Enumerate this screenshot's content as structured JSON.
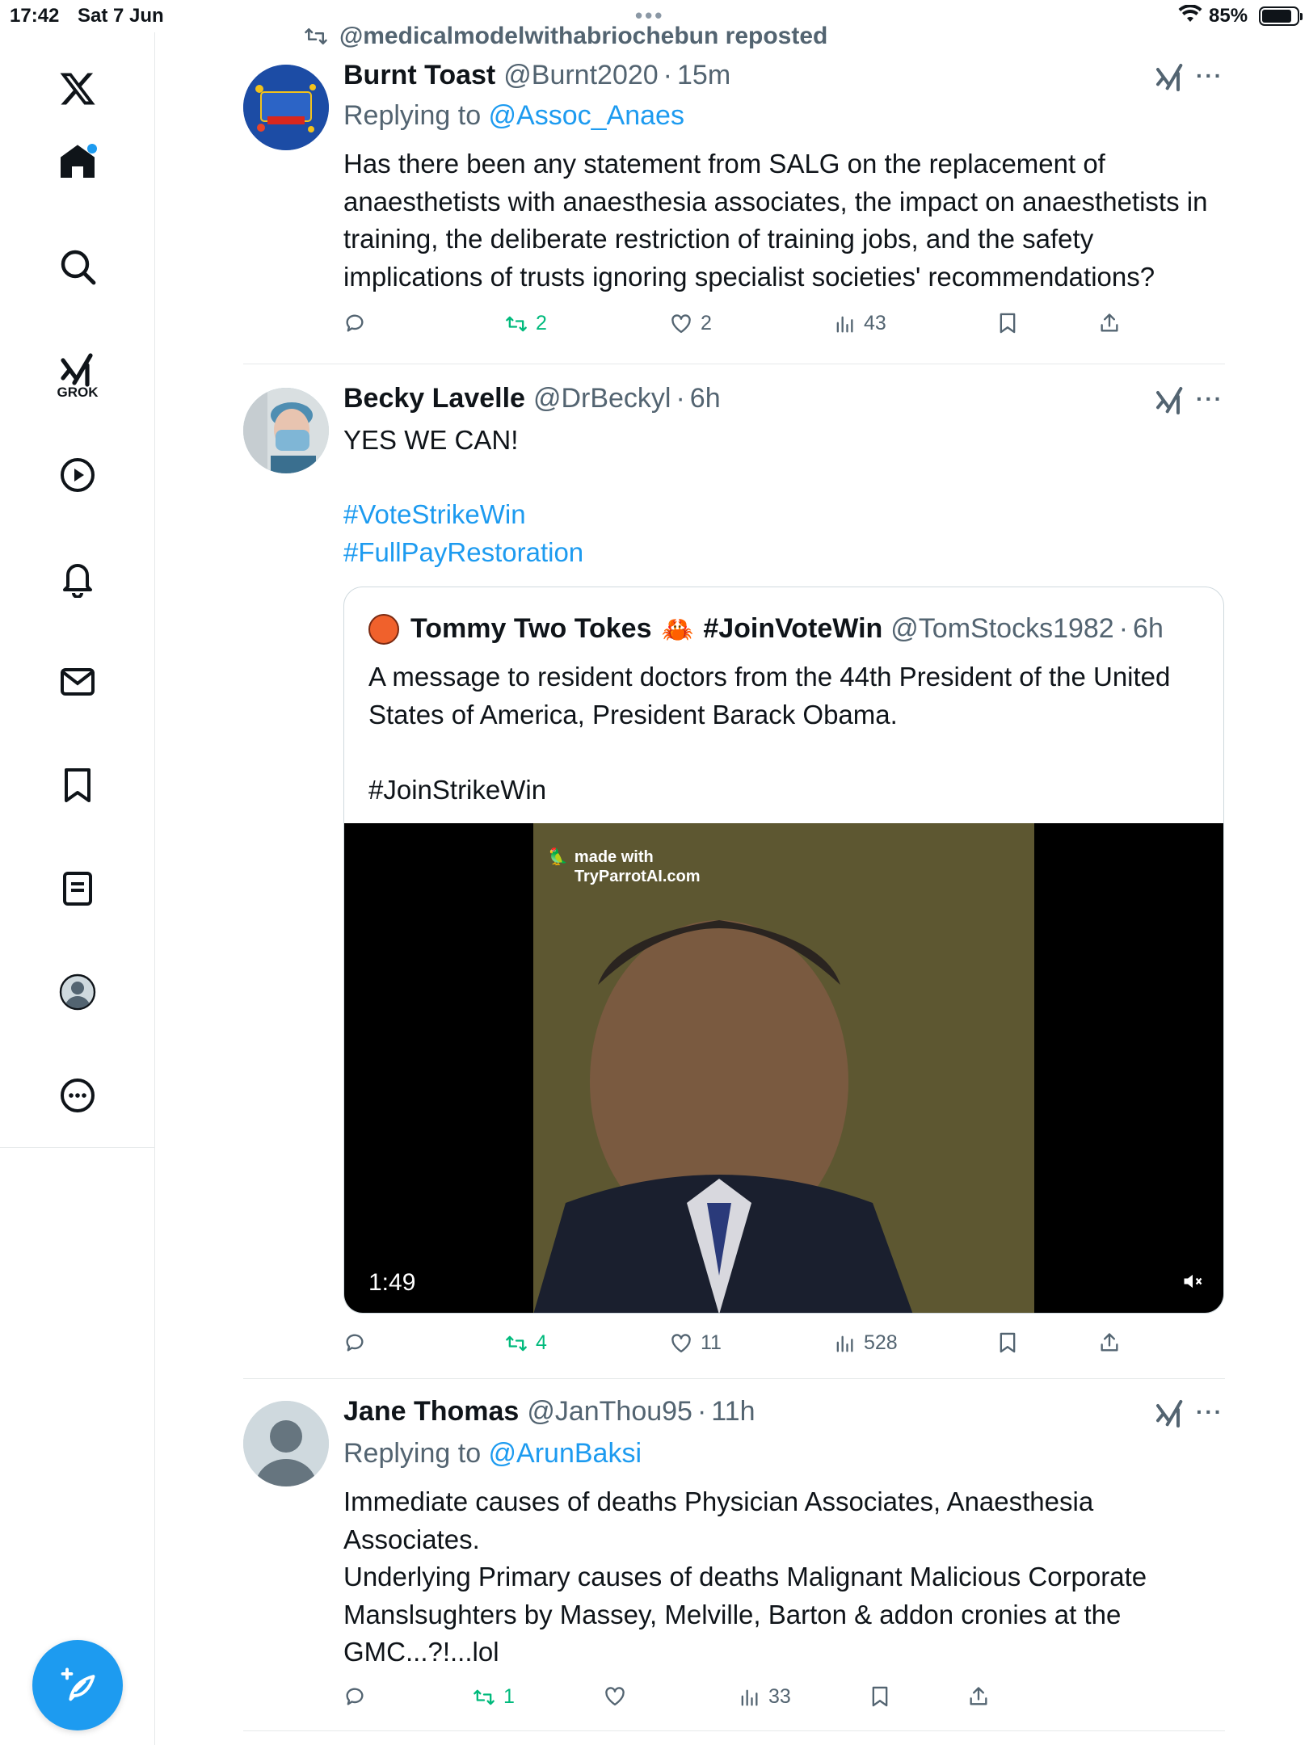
{
  "status_bar": {
    "time": "17:42",
    "date": "Sat 7 Jun",
    "battery": "85%",
    "battery_level": 0.85
  },
  "sidebar": {
    "grok_label": "GROK",
    "items": [
      "x-logo",
      "home",
      "search",
      "grok",
      "video",
      "notifications",
      "messages",
      "bookmarks",
      "lists",
      "profile",
      "more"
    ]
  },
  "tweets": [
    {
      "repost_by": "@medicalmodelwithabriochebun reposted",
      "name": "Burnt Toast",
      "handle": "@Burnt2020",
      "time": "15m",
      "replying_label": "Replying to ",
      "replying_to": "@Assoc_Anaes",
      "text": "Has there been any statement from SALG on the replacement of anaesthetists with anaesthesia associates, the impact on anaesthetists in training, the deliberate restriction of training jobs, and the safety implications of trusts ignoring specialist societies' recommendations?",
      "stats": {
        "replies": "",
        "reposts": "2",
        "likes": "2",
        "views": "43"
      }
    },
    {
      "name": "Becky Lavelle",
      "handle": "@DrBeckyl",
      "time": "6h",
      "text": "YES WE CAN!",
      "hashtags": [
        "#VoteStrikeWin",
        "#FullPayRestoration"
      ],
      "quote": {
        "name": "Tommy Two Tokes",
        "emoji": "🦀",
        "name_suffix": "#JoinVoteWin",
        "handle": "@TomStocks1982",
        "time": "6h",
        "text": "A message to resident doctors from the 44th President of the United States of America, President Barack Obama.",
        "hashtag": "#JoinStrikeWin",
        "video": {
          "watermark_line1": "made with",
          "watermark_line2": "TryParrotAI.com",
          "duration": "1:49"
        }
      },
      "stats": {
        "replies": "",
        "reposts": "4",
        "likes": "11",
        "views": "528"
      }
    },
    {
      "name": "Jane Thomas",
      "handle": "@JanThou95",
      "time": "11h",
      "replying_label": "Replying to ",
      "replying_to": "@ArunBaksi",
      "text_lines": [
        "Immediate causes of deaths Physician Associates, Anaesthesia Associates.",
        "Underlying Primary causes of deaths Malignant Malicious Corporate Manslsughters by Massey, Melville, Barton & addon cronies at the GMC...?!...lol"
      ],
      "stats": {
        "replies": "",
        "reposts": "1",
        "likes": "",
        "views": "33"
      }
    }
  ],
  "colors": {
    "accent": "#1d9bf0",
    "repost_green": "#00ba7c",
    "secondary_text": "#536471",
    "divider": "#e6e9ea"
  }
}
